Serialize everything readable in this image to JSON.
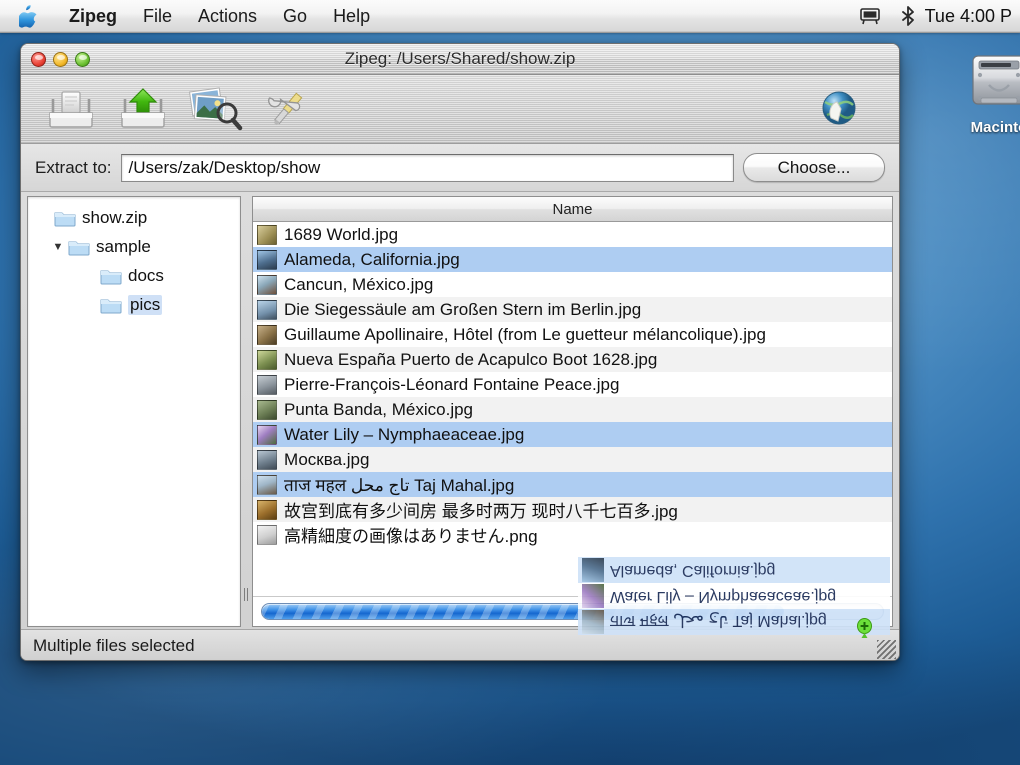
{
  "menubar": {
    "apple_icon": "apple-logo-icon",
    "items": [
      {
        "label": "Zipeg",
        "bold": true
      },
      {
        "label": "File",
        "bold": false
      },
      {
        "label": "Actions",
        "bold": false
      },
      {
        "label": "Go",
        "bold": false
      },
      {
        "label": "Help",
        "bold": false
      }
    ],
    "status_icons": [
      "display-icon",
      "bluetooth-icon"
    ],
    "clock": "Tue 4:00 P"
  },
  "window": {
    "title": "Zipeg: /Users/Shared/show.zip",
    "controls": {
      "close": "close-button",
      "minimize": "minimize-button",
      "zoom": "zoom-button"
    },
    "toolbar": [
      {
        "name": "open-button",
        "icon": "open-tray-icon"
      },
      {
        "name": "extract-button",
        "icon": "extract-up-arrow-icon"
      },
      {
        "name": "preview-button",
        "icon": "photos-preview-icon"
      },
      {
        "name": "tools-button",
        "icon": "wrench-screwdriver-icon"
      },
      {
        "name": "internet-button",
        "icon": "globe-pointer-icon"
      }
    ]
  },
  "extract_bar": {
    "label": "Extract to:",
    "path_value": "/Users/zak/Desktop/show",
    "path_placeholder": "/Users/zak/Desktop/show",
    "choose_label": "Choose..."
  },
  "tree": {
    "nodes": [
      {
        "label": "show.zip",
        "indent": 0,
        "twisty": "",
        "selected": false
      },
      {
        "label": "sample",
        "indent": 1,
        "twisty": "▼",
        "selected": false
      },
      {
        "label": "docs",
        "indent": 2,
        "twisty": "",
        "selected": false
      },
      {
        "label": "pics",
        "indent": 2,
        "twisty": "",
        "selected": true
      }
    ]
  },
  "file_list": {
    "column_header": "Name",
    "rows": [
      {
        "name": "1689 World.jpg",
        "selected": false
      },
      {
        "name": "Alameda, California.jpg",
        "selected": true
      },
      {
        "name": "Cancun, México.jpg",
        "selected": false
      },
      {
        "name": "Die Siegessäule am Großen Stern im Berlin.jpg",
        "selected": false
      },
      {
        "name": "Guillaume Apollinaire, Hôtel (from Le guetteur mélancolique).jpg",
        "selected": false
      },
      {
        "name": "Nueva España Puerto de Acapulco Boot 1628.jpg",
        "selected": false
      },
      {
        "name": "Pierre-François-Léonard Fontaine Peace.jpg",
        "selected": false
      },
      {
        "name": "Punta Banda, México.jpg",
        "selected": false
      },
      {
        "name": "Water Lily – Nymphaeaceae.jpg",
        "selected": true
      },
      {
        "name": "Москва.jpg",
        "selected": false
      },
      {
        "name": "ताज महल تاج محل Taj Mahal.jpg",
        "selected": true
      },
      {
        "name": "故宫到底有多少间房 最多时两万 现时八千七百多.jpg",
        "selected": false
      },
      {
        "name": "高精細度の画像はありません.png",
        "selected": false
      }
    ]
  },
  "progress": {
    "percent": 84
  },
  "status_bar": {
    "text": "Multiple files selected"
  },
  "drag_image": {
    "items": [
      {
        "name": "ताज महल تاج محل Taj Mahal.jpg"
      },
      {
        "name": "Water Lily – Nymphaeaceae.jpg"
      },
      {
        "name": "Alameda, California.jpg"
      }
    ],
    "badge": "green-plus-badge"
  },
  "desktop": {
    "icon_label": "Macinto",
    "icon_name": "hard-drive-icon",
    "accent_selection": "#aecdf2",
    "background": "#2f6ea8"
  }
}
